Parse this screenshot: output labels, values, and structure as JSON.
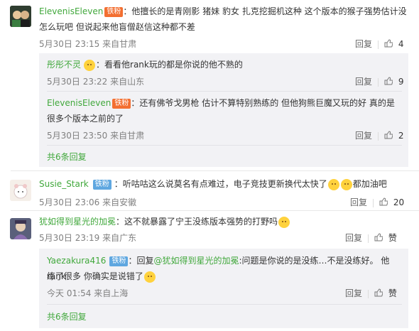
{
  "comments": [
    {
      "name": "ElevenisEleven",
      "badge": "铁粉",
      "text_line1": "：他擅长的是青刚影 猪妹 豹女 扎克挖掘机这种 这个版本的猴子强势估计没",
      "text_line2": "怎么玩吧 但说起来他盲僧赵信这种都不差",
      "meta": "5月30日 23:15 来自甘肃",
      "reply_label": "回复",
      "likes": "4",
      "replies": [
        {
          "name": "彤彤不灵",
          "text": "：看看他rank玩的都是你说的他不熟的",
          "meta": "5月30日 23:22 来自山东",
          "reply_label": "回复",
          "likes": "9"
        },
        {
          "name": "ElevenisEleven",
          "badge": "铁粉",
          "text_line1": "：还有佛爷戈男枪 估计不算特别熟练的 但他狗熊巨魔又玩的好 真的是",
          "text_line2": "很多个版本之前的了",
          "meta": "5月30日 23:50 来自甘肃",
          "reply_label": "回复",
          "likes": "2"
        }
      ],
      "more": "共6条回复"
    },
    {
      "name": "Susie_Stark",
      "badge": "铁粉",
      "text_a": "：听咕咕这么说莫名有点难过，电子竞技更新换代太快了",
      "text_b": "都加油吧",
      "meta": "5月30日 23:06 来自安徽",
      "reply_label": "回复",
      "likes": "20"
    },
    {
      "name": "犹如得到星光的加冕",
      "text": "：这不就暴露了宁王没练版本强势的打野吗",
      "meta": "5月30日 23:19 来自广东",
      "reply_label": "回复",
      "like_label": "赞",
      "replies": [
        {
          "name": "Yaezakura416",
          "badge": "铁粉",
          "prefix": "：回复",
          "mention": "@犹如得到星光的加冕",
          "text_line1": ":问题是你说的是没练…不是没练好。 他rank",
          "text_line2": "练了很多 你确实是说错了",
          "meta": "今天 01:54 来自上海",
          "reply_label": "回复",
          "like_label": "赞"
        }
      ],
      "more": "共6条回复"
    }
  ],
  "colors": {
    "name_orange": "#eb7350",
    "name_green": "#41a83c",
    "badge_orange": "#f36f31",
    "badge_blue": "#5fa7e0",
    "sub_bg": "#f2f2f5"
  },
  "icons": [
    "avatar",
    "fan-badge-icon",
    "emoji-icon",
    "reply-icon",
    "like-icon"
  ]
}
